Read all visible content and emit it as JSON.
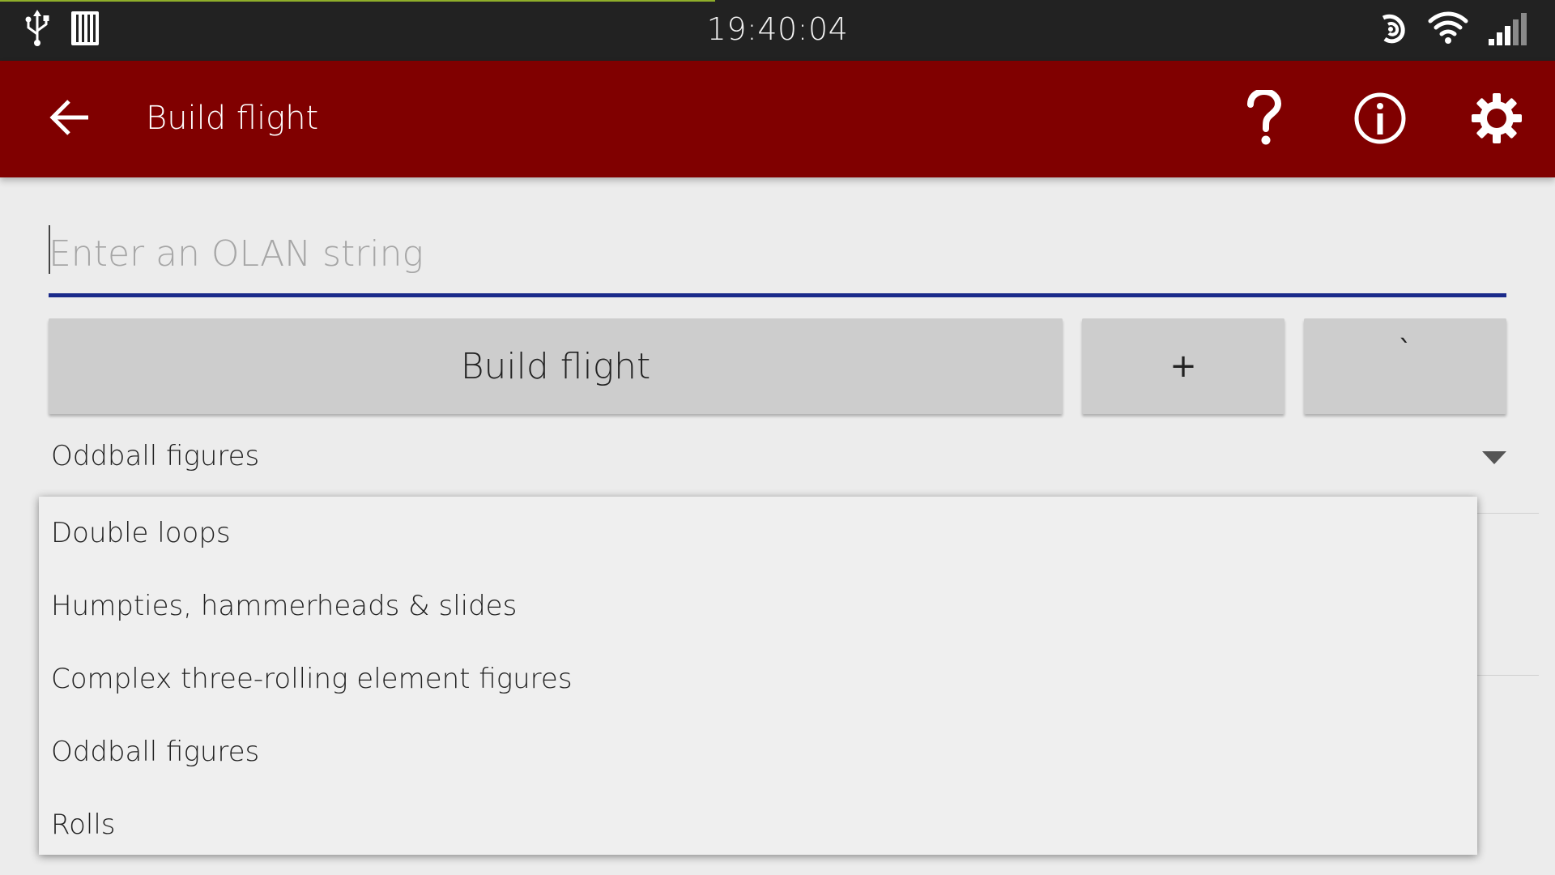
{
  "status_bar": {
    "clock": "19:40:04",
    "icons": [
      "usb-icon",
      "storage-icon",
      "nfc-icon",
      "wifi-icon",
      "signal-icon"
    ]
  },
  "toolbar": {
    "title": "Build flight",
    "background_color": "#800000",
    "icons": [
      "back-arrow-icon",
      "help-icon",
      "info-icon",
      "settings-icon"
    ]
  },
  "olan_input": {
    "value": "",
    "placeholder": "Enter an OLAN string",
    "underline_color": "#1a2a8a"
  },
  "buttons": {
    "build_label": "Build flight",
    "plus_label": "+",
    "tick_label": "`"
  },
  "spinner": {
    "selected": "Oddball figures"
  },
  "dropdown": {
    "items": [
      {
        "label": "Double loops"
      },
      {
        "label": "Humpties, hammerheads & slides"
      },
      {
        "label": "Complex three-rolling element figures"
      },
      {
        "label": "Oddball figures"
      },
      {
        "label": "Rolls"
      }
    ]
  }
}
